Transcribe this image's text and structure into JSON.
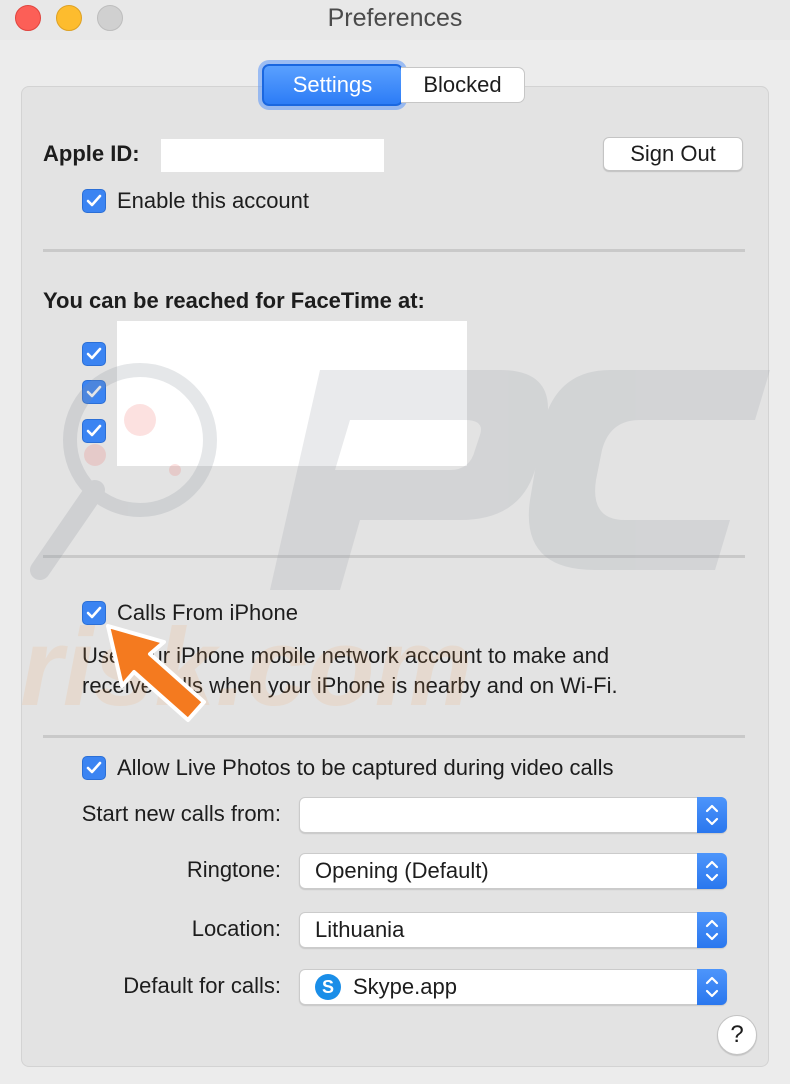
{
  "window": {
    "title": "Preferences"
  },
  "tabs": [
    {
      "label": "Settings",
      "selected": true
    },
    {
      "label": "Blocked",
      "selected": false
    }
  ],
  "account": {
    "apple_id_label": "Apple ID:",
    "apple_id_value": "",
    "sign_out_label": "Sign Out",
    "enable_label": "Enable this account",
    "enable_checked": true
  },
  "facetime": {
    "heading": "You can be reached for FaceTime at:",
    "addresses": [
      {
        "checked": true,
        "value": ""
      },
      {
        "checked": true,
        "value": ""
      },
      {
        "checked": true,
        "value": ""
      }
    ]
  },
  "calls_from_iphone": {
    "label": "Calls From iPhone",
    "checked": true,
    "description_line1": "Use your iPhone mobile network account to make and",
    "description_line2": "receive calls when your iPhone is nearby and on Wi-Fi."
  },
  "live_photos": {
    "label": "Allow Live Photos to be captured during video calls",
    "checked": true
  },
  "settings": {
    "start_calls_label": "Start new calls from:",
    "start_calls_value": "",
    "ringtone_label": "Ringtone:",
    "ringtone_value": "Opening (Default)",
    "location_label": "Location:",
    "location_value": "Lithuania",
    "default_calls_label": "Default for calls:",
    "default_calls_value": "Skype.app"
  },
  "help_label": "?",
  "watermark": {
    "text": "risk.com"
  },
  "colors": {
    "accent": "#2c7cf6",
    "checkbox": "#3b84f2",
    "arrow": "#f47a1f"
  }
}
